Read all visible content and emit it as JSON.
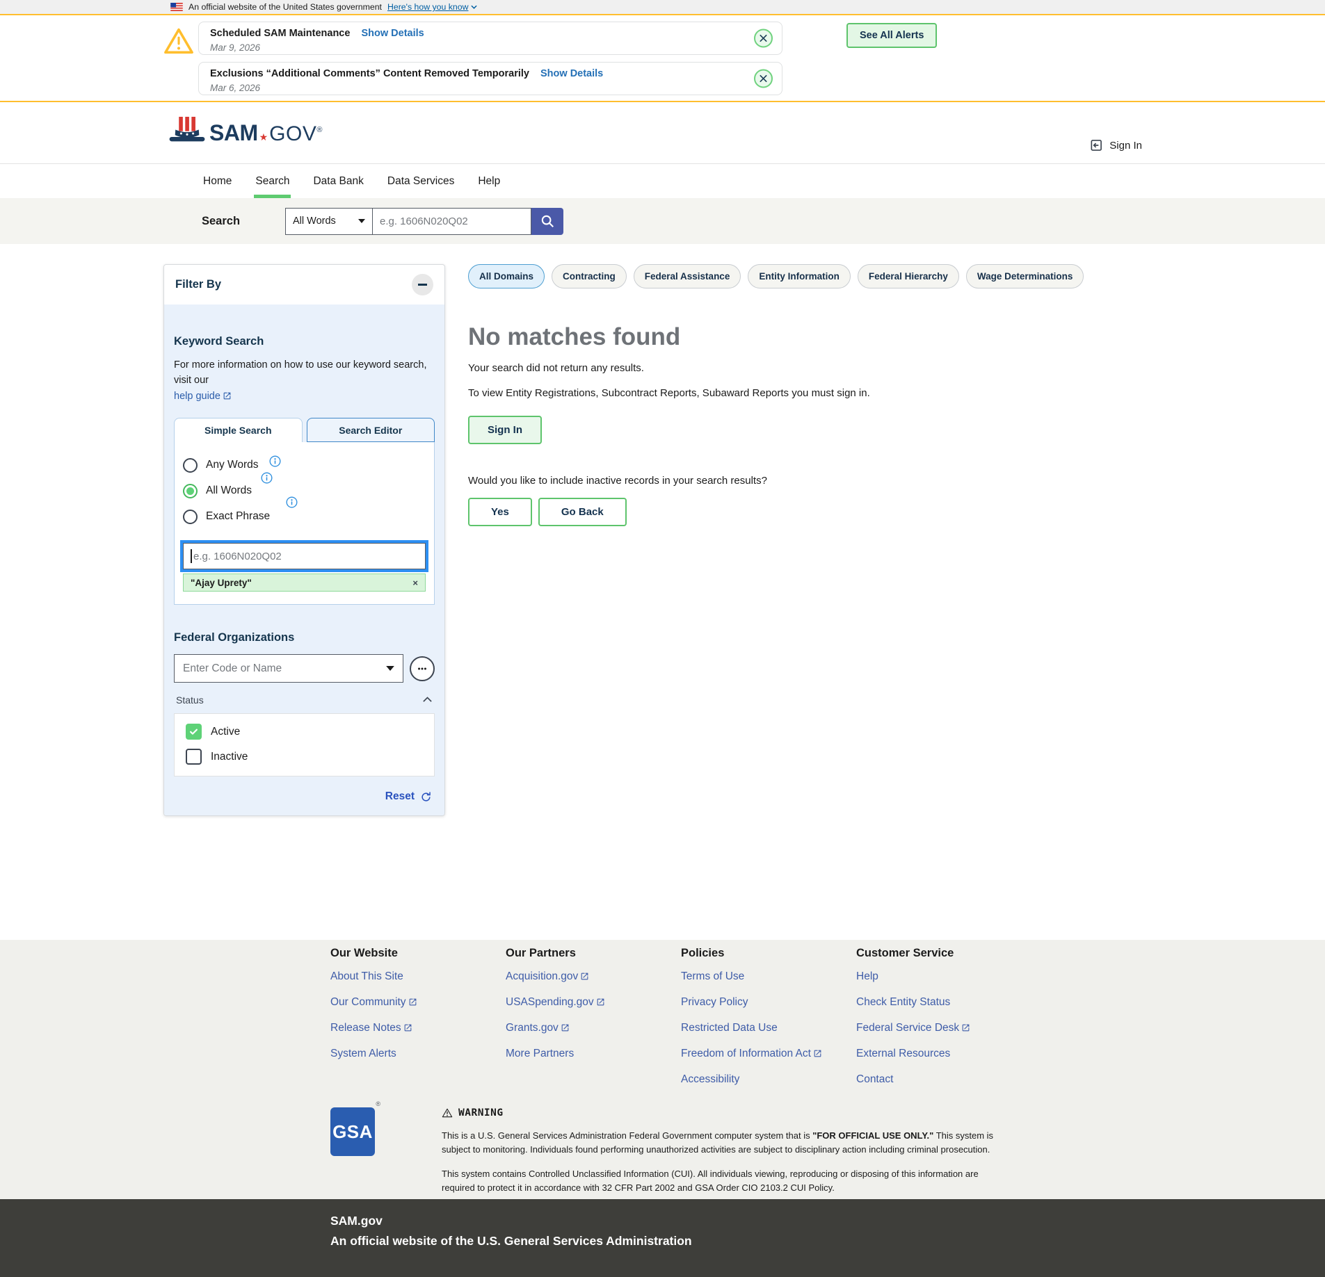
{
  "banner": {
    "text": "An official website of the United States government",
    "link_label": "Here's how you know"
  },
  "alerts": {
    "see_all": "See All Alerts",
    "items": [
      {
        "title": "Scheduled SAM Maintenance",
        "details": "Show Details",
        "date": "Mar 9, 2026"
      },
      {
        "title": "Exclusions “Additional Comments” Content Removed Temporarily",
        "details": "Show Details",
        "date": "Mar 6, 2026"
      }
    ]
  },
  "header": {
    "logo": {
      "sam": "SAM",
      "star": "★",
      "gov": "GOV",
      "reg": "®"
    },
    "sign_in": "Sign In"
  },
  "nav": {
    "items": [
      {
        "label": "Home"
      },
      {
        "label": "Search"
      },
      {
        "label": "Data Bank"
      },
      {
        "label": "Data Services"
      },
      {
        "label": "Help"
      }
    ]
  },
  "search_bar": {
    "label": "Search",
    "mode_selected": "All Words",
    "placeholder": "e.g. 1606N020Q02"
  },
  "filter_panel": {
    "title": "Filter By",
    "keyword": {
      "heading": "Keyword Search",
      "help_text": "For more information on how to use our keyword search, visit our",
      "help_link": "help guide",
      "tabs": [
        {
          "label": "Simple Search"
        },
        {
          "label": "Search Editor"
        }
      ],
      "options": [
        {
          "label": "Any Words"
        },
        {
          "label": "All Words"
        },
        {
          "label": "Exact Phrase"
        }
      ],
      "placeholder": "e.g. 1606N020Q02",
      "chip": "\"Ajay Uprety\"",
      "chip_close": "×"
    },
    "federal_orgs": {
      "heading": "Federal Organizations",
      "placeholder": "Enter Code or Name",
      "status": {
        "label": "Status",
        "options": [
          {
            "label": "Active"
          },
          {
            "label": "Inactive"
          }
        ]
      }
    },
    "reset": "Reset"
  },
  "domains": {
    "items": [
      {
        "label": "All Domains"
      },
      {
        "label": "Contracting"
      },
      {
        "label": "Federal Assistance"
      },
      {
        "label": "Entity Information"
      },
      {
        "label": "Federal Hierarchy"
      },
      {
        "label": "Wage Determinations"
      }
    ]
  },
  "results": {
    "heading": "No matches found",
    "message": "Your search did not return any results.",
    "signin_note": "To view Entity Registrations, Subcontract Reports, Subaward Reports you must sign in.",
    "sign_in": "Sign In",
    "inactive_question": "Would you like to include inactive records in your search results?",
    "yes": "Yes",
    "go_back": "Go Back"
  },
  "footer": {
    "columns": [
      {
        "heading": "Our Website",
        "links": [
          {
            "label": "About This Site"
          },
          {
            "label": "Our Community"
          },
          {
            "label": "Release Notes"
          },
          {
            "label": "System Alerts"
          }
        ]
      },
      {
        "heading": "Our Partners",
        "links": [
          {
            "label": "Acquisition.gov"
          },
          {
            "label": "USASpending.gov"
          },
          {
            "label": "Grants.gov"
          },
          {
            "label": "More Partners"
          }
        ]
      },
      {
        "heading": "Policies",
        "links": [
          {
            "label": "Terms of Use"
          },
          {
            "label": "Privacy Policy"
          },
          {
            "label": "Restricted Data Use"
          },
          {
            "label": "Freedom of Information Act"
          },
          {
            "label": "Accessibility"
          }
        ]
      },
      {
        "heading": "Customer Service",
        "links": [
          {
            "label": "Help"
          },
          {
            "label": "Check Entity Status"
          },
          {
            "label": "Federal Service Desk"
          },
          {
            "label": "External Resources"
          },
          {
            "label": "Contact"
          }
        ]
      }
    ],
    "gsa": {
      "logo": "GSA",
      "reg": "®"
    },
    "warning": {
      "heading": "WARNING",
      "p1_a": "This is a U.S. General Services Administration Federal Government computer system that is ",
      "p1_b": "\"FOR OFFICIAL USE ONLY.\"",
      "p1_c": " This system is subject to monitoring. Individuals found performing unauthorized activities are subject to disciplinary action including criminal prosecution.",
      "p2": "This system contains Controlled Unclassified Information (CUI). All individuals viewing, reproducing or disposing of this information are required to protect it in accordance with 32 CFR Part 2002 and GSA Order CIO 2103.2 CUI Policy."
    },
    "dark": {
      "title": "SAM.gov",
      "subtitle": "An official website of the U.S. General Services Administration"
    }
  },
  "colors": {
    "gold": "#ffbe2e",
    "accent_green": "#5ec46c",
    "primary_indigo": "#4a59a8",
    "link_blue": "#2a5caa",
    "navy": "#1d3c5e"
  }
}
